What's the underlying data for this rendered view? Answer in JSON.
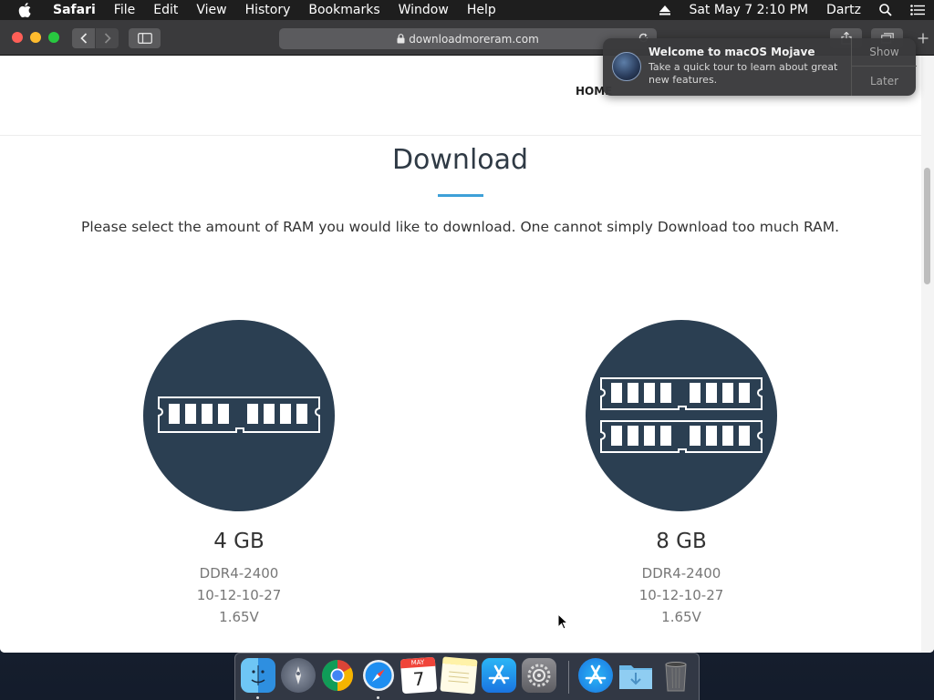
{
  "menubar": {
    "app_name": "Safari",
    "items": [
      "File",
      "Edit",
      "View",
      "History",
      "Bookmarks",
      "Window",
      "Help"
    ],
    "datetime": "Sat May 7  2:10 PM",
    "user": "Dartz"
  },
  "browser": {
    "url": "downloadmoreram.com"
  },
  "site": {
    "nav_home": "HOME",
    "title": "Download",
    "intro": "Please select the amount of RAM you would like to download. One cannot simply Download too much RAM.",
    "accent_color": "#3ea0d8",
    "circle_color": "#2b3f52",
    "products": [
      {
        "size": "4 GB",
        "type": "DDR4-2400",
        "timings": "10-12-10-27",
        "voltage": "1.65V",
        "icon": "ram-stick-icon"
      },
      {
        "size": "8 GB",
        "type": "DDR4-2400",
        "timings": "10-12-10-27",
        "voltage": "1.65V",
        "icon": "ram-two-sticks-icon"
      }
    ]
  },
  "notification": {
    "title": "Welcome to macOS Mojave",
    "body": "Take a quick tour to learn about great new features.",
    "show_label": "Show",
    "later_label": "Later"
  },
  "dock": {
    "apps": [
      "Finder",
      "Launchpad",
      "Chrome",
      "Safari",
      "Calendar",
      "Notes",
      "App Store",
      "System Preferences",
      "App Store",
      "Downloads",
      "Trash"
    ],
    "calendar_month": "MAY",
    "calendar_day": "7"
  }
}
